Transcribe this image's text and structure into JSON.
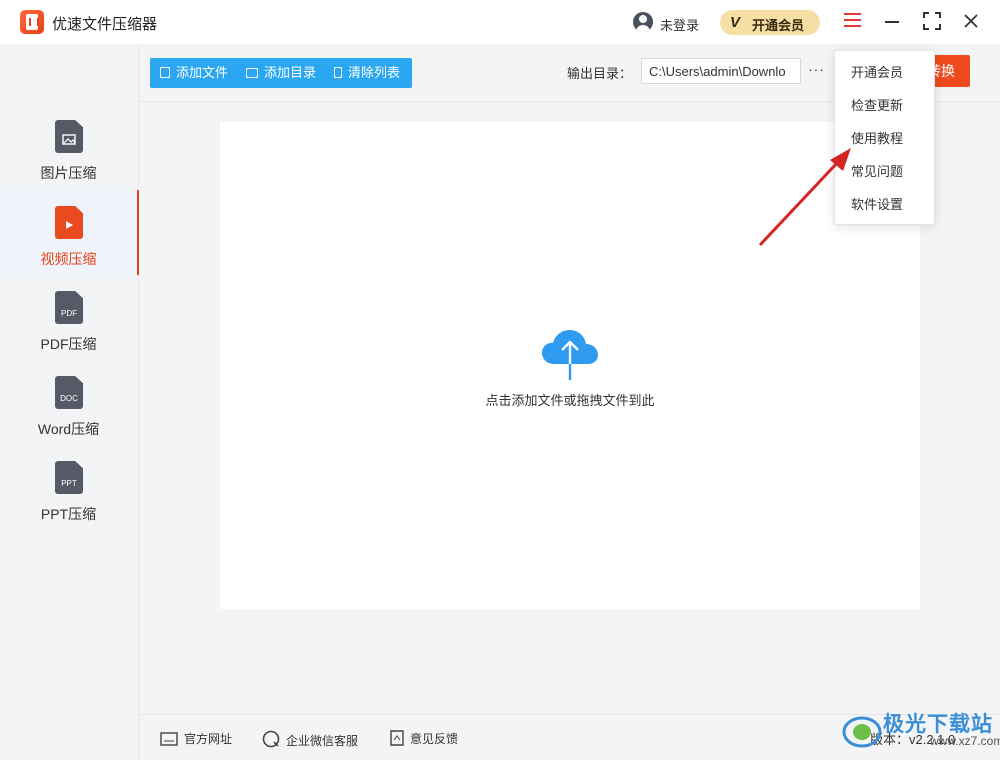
{
  "app": {
    "title": "优速文件压缩器"
  },
  "header": {
    "login_text": "未登录",
    "vip_icon": "V",
    "vip_label": "开通会员"
  },
  "sidebar": {
    "items": [
      {
        "label": "图片压缩",
        "tag": "",
        "icon": "image-file-icon",
        "active": false
      },
      {
        "label": "视频压缩",
        "tag": "",
        "icon": "video-file-icon",
        "active": true
      },
      {
        "label": "PDF压缩",
        "tag": "PDF",
        "icon": "pdf-file-icon",
        "active": false
      },
      {
        "label": "Word压缩",
        "tag": "DOC",
        "icon": "doc-file-icon",
        "active": false
      },
      {
        "label": "PPT压缩",
        "tag": "PPT",
        "icon": "ppt-file-icon",
        "active": false
      }
    ]
  },
  "toolbar": {
    "add_file": "添加文件",
    "add_folder": "添加目录",
    "clear_list": "清除列表",
    "output_label": "输出目录：",
    "output_path": "C:\\Users\\admin\\Downlo",
    "more": "···",
    "convert": "转换"
  },
  "drop_area": {
    "text": "点击添加文件或拖拽文件到此"
  },
  "menu": {
    "items": [
      "开通会员",
      "检查更新",
      "使用教程",
      "常见问题",
      "软件设置"
    ]
  },
  "footer": {
    "website": "官方网址",
    "wechat": "企业微信客服",
    "feedback": "意见反馈",
    "version": "版本：v2.2.1.0"
  },
  "watermark": {
    "text": "极光下载站",
    "url": "www.xz7.com"
  },
  "colors": {
    "accent": "#ef4a1d",
    "toolbar_blue": "#2aa7f0",
    "vip_gold": "#f6dfa4",
    "annotation_arrow": "#d42424"
  }
}
